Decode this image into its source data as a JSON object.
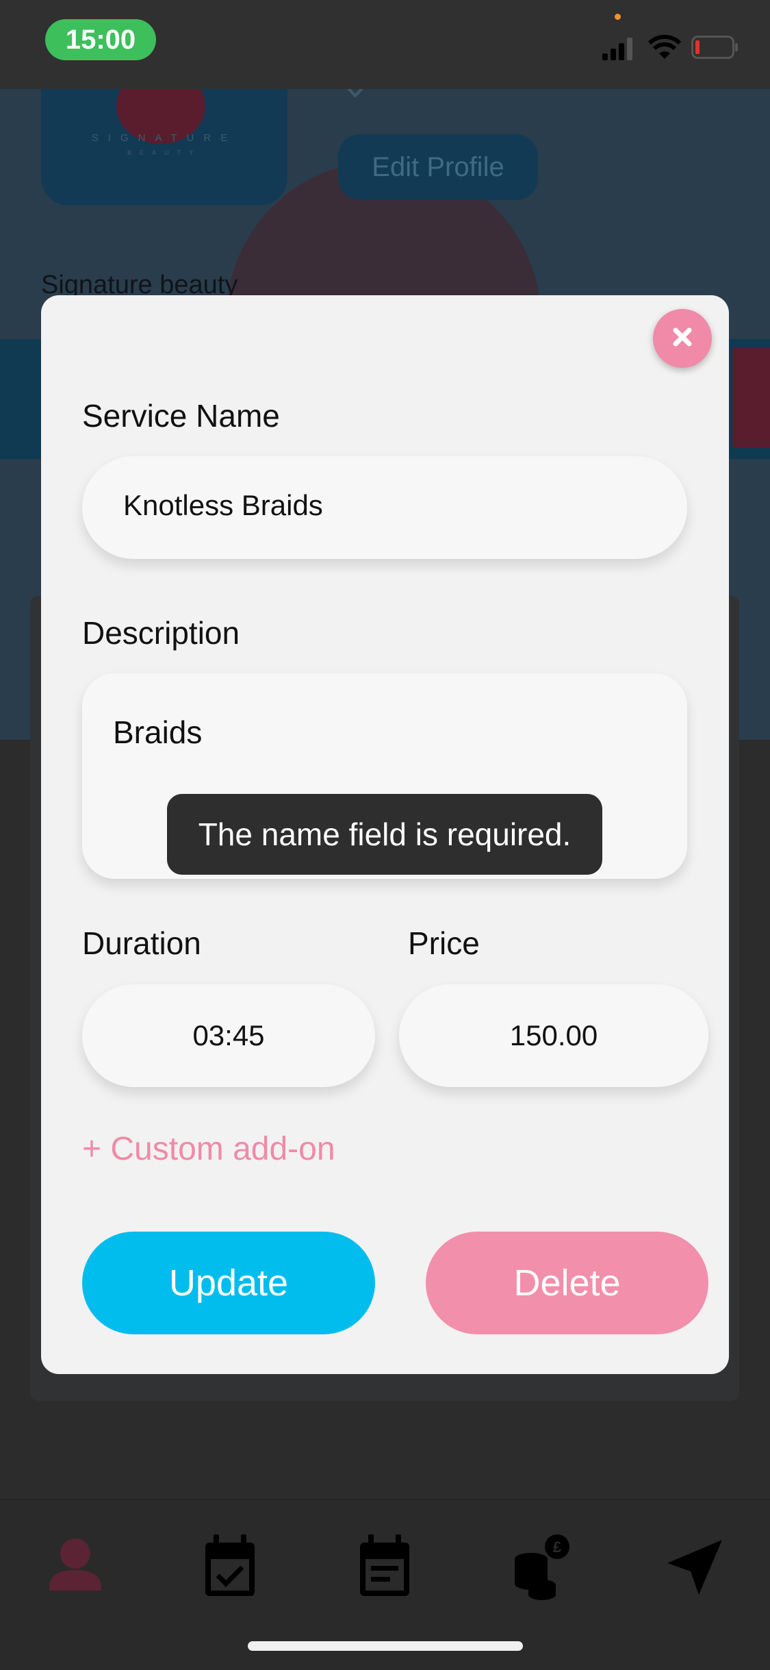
{
  "status_bar": {
    "time": "15:00"
  },
  "background": {
    "edit_profile_label": "Edit Profile",
    "salon_name": "Signature beauty",
    "logo_text": "SIGNATURE",
    "logo_subtext": "BEAUTY"
  },
  "modal": {
    "service_name_label": "Service Name",
    "service_name_value": "Knotless Braids",
    "description_label": "Description",
    "description_value": "Braids",
    "validation_message": "The name field is required.",
    "duration_label": "Duration",
    "duration_value": "03:45",
    "price_label": "Price",
    "price_value": "150.00",
    "custom_addon_label": "+ Custom add-on",
    "update_label": "Update",
    "delete_label": "Delete"
  },
  "tab_bar": {
    "items": [
      {
        "icon": "profile-icon"
      },
      {
        "icon": "calendar-check-icon"
      },
      {
        "icon": "calendar-list-icon"
      },
      {
        "icon": "coins-pound-icon"
      },
      {
        "icon": "navigation-arrow-icon"
      }
    ]
  },
  "colors": {
    "accent_pink": "#f08aa8",
    "update_blue": "#00bdee",
    "delete_pink": "#f28fab",
    "status_green": "#3dbf5c",
    "battery_red": "#e0332f"
  }
}
